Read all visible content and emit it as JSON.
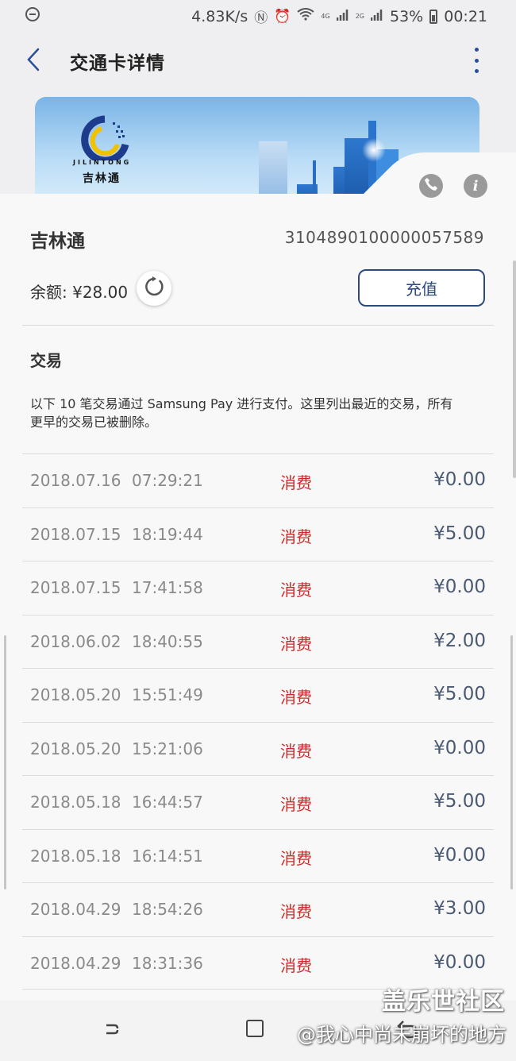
{
  "status_bar": {
    "speed": "4.83K/s",
    "network_4g": "4G",
    "network_2g": "2G",
    "battery": "53%",
    "time": "00:21"
  },
  "header": {
    "title": "交通卡详情"
  },
  "card_image": {
    "brand_en": "JILINTONG",
    "brand_cn": "吉林通"
  },
  "card": {
    "name": "吉林通",
    "number": "3104890100000057589",
    "balance_label": "余额: ¥28.00",
    "recharge_label": "充值"
  },
  "transactions": {
    "title": "交易",
    "notice": "以下 10 笔交易通过 Samsung Pay 进行支付。这里列出最近的交易，所有更早的交易已被删除。",
    "items": [
      {
        "date": "2018.07.16",
        "time": "07:29:21",
        "type": "消费",
        "amount": "¥0.00"
      },
      {
        "date": "2018.07.15",
        "time": "18:19:44",
        "type": "消费",
        "amount": "¥5.00"
      },
      {
        "date": "2018.07.15",
        "time": "17:41:58",
        "type": "消费",
        "amount": "¥0.00"
      },
      {
        "date": "2018.06.02",
        "time": "18:40:55",
        "type": "消费",
        "amount": "¥2.00"
      },
      {
        "date": "2018.05.20",
        "time": "15:51:49",
        "type": "消费",
        "amount": "¥5.00"
      },
      {
        "date": "2018.05.20",
        "time": "15:21:06",
        "type": "消费",
        "amount": "¥0.00"
      },
      {
        "date": "2018.05.18",
        "time": "16:44:57",
        "type": "消费",
        "amount": "¥5.00"
      },
      {
        "date": "2018.05.18",
        "time": "16:14:51",
        "type": "消费",
        "amount": "¥0.00"
      },
      {
        "date": "2018.04.29",
        "time": "18:54:26",
        "type": "消费",
        "amount": "¥3.00"
      },
      {
        "date": "2018.04.29",
        "time": "18:31:36",
        "type": "消费",
        "amount": "¥0.00"
      }
    ]
  },
  "watermark": {
    "line1": "盖乐世社区",
    "line2": "@我心中尚未崩坏的地方"
  },
  "colors": {
    "accent": "#2d4a7c",
    "expense_red": "#cc2a2a",
    "amount": "#4a5a72"
  },
  "icons": {
    "back": "chevron-left-icon",
    "more": "more-vertical-icon",
    "refresh": "refresh-icon",
    "call": "phone-icon",
    "info": "info-icon"
  }
}
